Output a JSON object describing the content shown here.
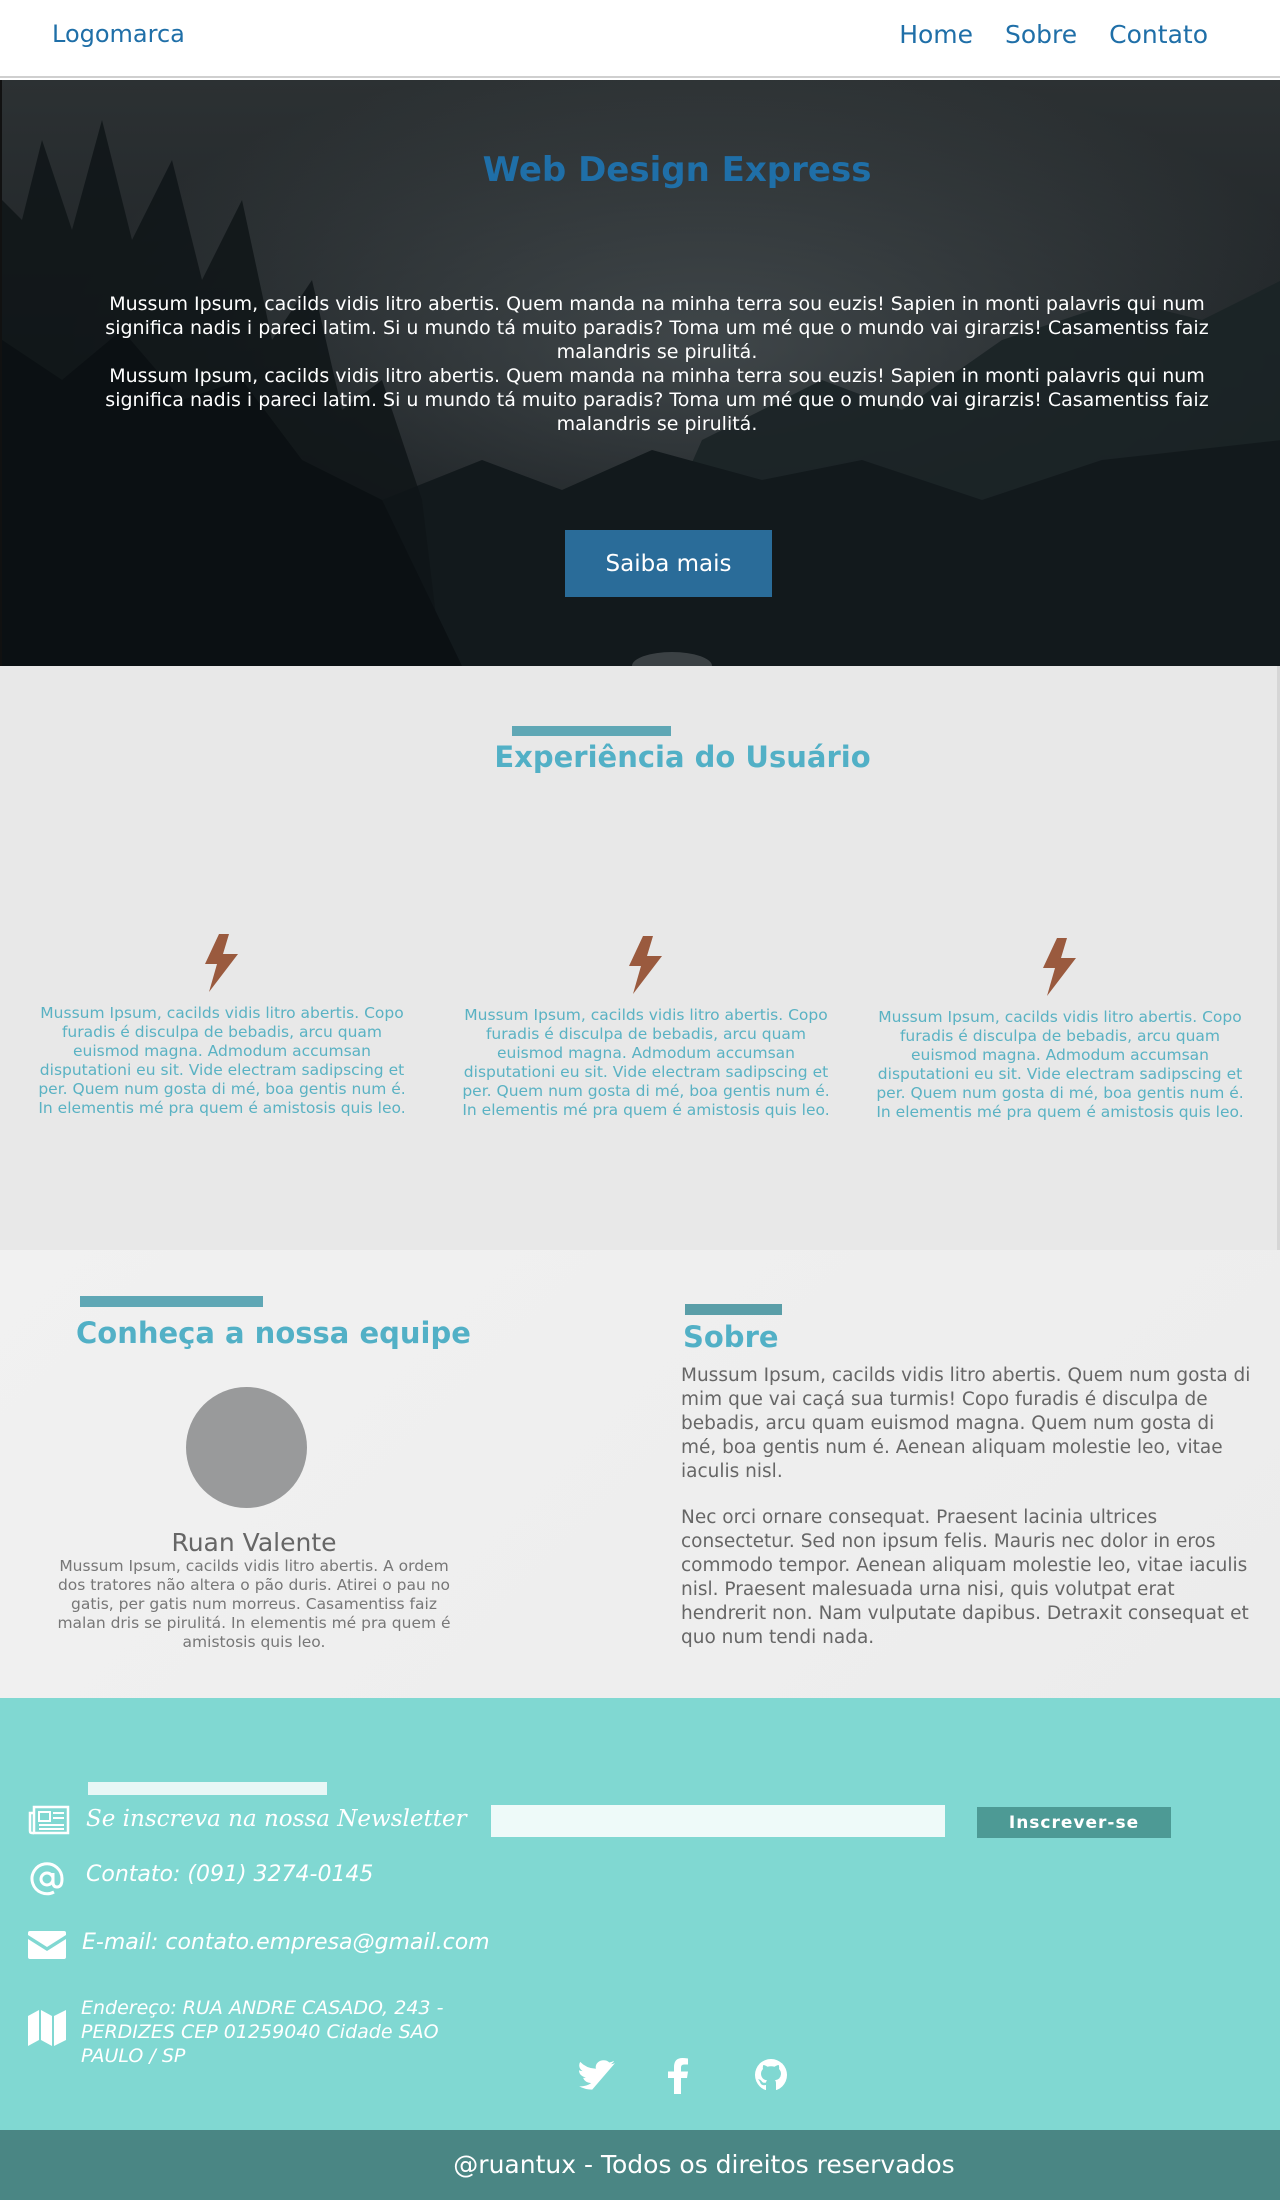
{
  "header": {
    "logo": "Logomarca",
    "nav": [
      "Home",
      "Sobre",
      "Contato"
    ]
  },
  "hero": {
    "title": "Web Design Express",
    "paragraphs": [
      "Mussum Ipsum, cacilds vidis litro abertis. Quem manda na minha terra sou euzis! Sapien in monti palavris qui num significa nadis i pareci latim. Si u mundo tá muito paradis? Toma um mé que o mundo vai girarzis! Casamentiss faiz malandris se pirulitá.",
      "Mussum Ipsum, cacilds vidis litro abertis. Quem manda na minha terra sou euzis! Sapien in monti palavris qui num significa nadis i pareci latim. Si u mundo tá muito paradis? Toma um mé que o mundo vai girarzis! Casamentiss faiz malandris se pirulitá."
    ],
    "button": "Saiba mais"
  },
  "experience": {
    "title": "Experiência do Usuário",
    "icon": "lightning-bolt-icon",
    "features": [
      "Mussum Ipsum, cacilds vidis litro abertis. Copo furadis é disculpa de bebadis, arcu quam euismod magna. Admodum accumsan disputationi eu sit. Vide electram sadipscing et per. Quem num gosta di mé, boa gentis num é. In elementis mé pra quem é amistosis quis leo.",
      "Mussum Ipsum, cacilds vidis litro abertis. Copo furadis é disculpa de bebadis, arcu quam euismod magna. Admodum accumsan disputationi eu sit. Vide electram sadipscing et per. Quem num gosta di mé, boa gentis num é. In elementis mé pra quem é amistosis quis leo.",
      "Mussum Ipsum, cacilds vidis litro abertis. Copo furadis é disculpa de bebadis, arcu quam euismod magna. Admodum accumsan disputationi eu sit. Vide electram sadipscing et per. Quem num gosta di mé, boa gentis num é. In elementis mé pra quem é amistosis quis leo."
    ]
  },
  "team": {
    "title": "Conheça a nossa equipe",
    "member_name": "Ruan Valente",
    "member_bio": "Mussum Ipsum, cacilds vidis litro abertis. A ordem dos tratores não altera o pão duris. Atirei o pau no gatis, per gatis num morreus. Casamentiss faiz malan dris se pirulitá. In elementis mé pra quem é amistosis quis leo."
  },
  "about": {
    "title": "Sobre",
    "paragraphs": [
      "Mussum Ipsum, cacilds vidis litro abertis. Quem num gosta di mim que vai caçá sua turmis! Copo furadis é disculpa de bebadis, arcu quam euismod magna. Quem num gosta di mé, boa gentis num é. Aenean aliquam molestie leo, vitae iaculis nisl.",
      "Nec orci ornare consequat. Praesent lacinia ultrices consectetur. Sed non ipsum felis. Mauris nec dolor in eros commodo tempor. Aenean aliquam molestie leo, vitae iaculis nisl. Praesent malesuada urna nisi, quis volutpat erat hendrerit non. Nam vulputate dapibus. Detraxit consequat et quo num tendi nada."
    ]
  },
  "contact": {
    "newsletter_label": "Se inscreva na nossa Newsletter",
    "newsletter_placeholder": "",
    "subscribe_button": "Inscrever-se",
    "phone": "Contato: (091) 3274-0145",
    "email": "E-mail: contato.empresa@gmail.com",
    "address": "Endereço: RUA ANDRE CASADO, 243 - PERDIZES CEP 01259040 Cidade SAO PAULO / SP",
    "icons": [
      "newspaper-icon",
      "at-sign-icon",
      "envelope-icon",
      "map-icon"
    ],
    "social": [
      "twitter-icon",
      "facebook-icon",
      "github-icon"
    ]
  },
  "footer": {
    "copyright": "@ruantux - Todos os direitos reservados"
  },
  "colors": {
    "brand_blue": "#1f6fa8",
    "accent_teal": "#52b0c6",
    "footer_bg": "#80d8d2",
    "bottom_bar": "#4a8684",
    "bolt": "#9a5a3e"
  }
}
